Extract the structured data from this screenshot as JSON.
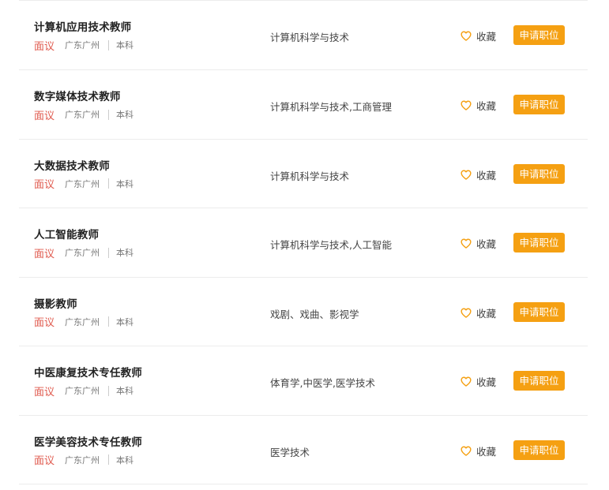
{
  "colors": {
    "salary": "#e05a4e",
    "accent": "#f5a012",
    "heart": "#f5a012",
    "text": "#222222",
    "muted": "#777777",
    "divider": "#ececec"
  },
  "labels": {
    "favorite": "收藏",
    "apply": "申请职位"
  },
  "jobs": [
    {
      "title": "计算机应用技术教师",
      "salary": "面议",
      "location": "广东广州",
      "degree": "本科",
      "major": "计算机科学与技术"
    },
    {
      "title": "数字媒体技术教师",
      "salary": "面议",
      "location": "广东广州",
      "degree": "本科",
      "major": "计算机科学与技术,工商管理"
    },
    {
      "title": "大数据技术教师",
      "salary": "面议",
      "location": "广东广州",
      "degree": "本科",
      "major": "计算机科学与技术"
    },
    {
      "title": "人工智能教师",
      "salary": "面议",
      "location": "广东广州",
      "degree": "本科",
      "major": "计算机科学与技术,人工智能"
    },
    {
      "title": "摄影教师",
      "salary": "面议",
      "location": "广东广州",
      "degree": "本科",
      "major": "戏剧、戏曲、影视学"
    },
    {
      "title": "中医康复技术专任教师",
      "salary": "面议",
      "location": "广东广州",
      "degree": "本科",
      "major": "体育学,中医学,医学技术"
    },
    {
      "title": "医学美容技术专任教师",
      "salary": "面议",
      "location": "广东广州",
      "degree": "本科",
      "major": "医学技术"
    }
  ]
}
